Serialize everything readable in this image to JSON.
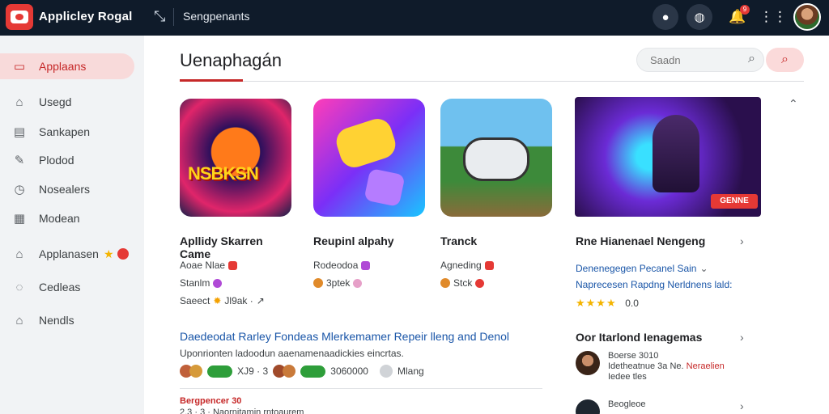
{
  "app": {
    "title": "Applicley Rogal",
    "breadcrumb": "Sengpenants"
  },
  "topbar": {
    "notification_count": "9"
  },
  "sidebar": {
    "items": [
      {
        "label": "Applaans",
        "icon": "store-icon",
        "active": true
      },
      {
        "label": "Usegd",
        "icon": "bag-icon"
      },
      {
        "label": "Sankapen",
        "icon": "library-icon"
      },
      {
        "label": "Plodod",
        "icon": "edit-icon"
      },
      {
        "label": "Nosealers",
        "icon": "clock-icon"
      },
      {
        "label": "Modean",
        "icon": "grid-icon"
      },
      {
        "label": "Applanasen",
        "icon": "home-icon"
      },
      {
        "label": "Cedleas",
        "icon": "chat-icon"
      },
      {
        "label": "Nendls",
        "icon": "house-icon"
      }
    ]
  },
  "main": {
    "title": "Uenaphagán",
    "search": {
      "placeholder": "Saadn"
    },
    "apps": [
      {
        "name": "Apllidy Skarren Came",
        "meta1": "Aoae Nlae",
        "meta2": "Stanlm",
        "meta3": "Saeect",
        "meta3b": "Jl9ak ·",
        "image_text": "NSBKSN"
      },
      {
        "name": "Reupinl alpahy",
        "meta1": "Rodeodoa",
        "meta2": "3ptek"
      },
      {
        "name": "Tranck",
        "meta1": "Agneding",
        "meta2": "Stck"
      }
    ],
    "featured_app": {
      "name": "Rne Hianenael Nengeng",
      "tag": "GENNE",
      "line1": "Denenegegen Pecanel Sain",
      "line2": "Naprecesen Rapdng Nerldnens lald:",
      "rating": "0.0"
    },
    "article": {
      "title": "Daedeodat Rarley Fondeas Mlerkemamer Repeir lleng and Denol",
      "subtitle": "Uponrionten ladoodun aaenamenaadickies eincrtas.",
      "meta_left": "XJ9 · 3",
      "meta_right": "3060000",
      "meta_name": "Mlang",
      "footer_label": "Bergpencer 30",
      "footer_text": "2.3 · 3 · Naornitamin rntoaurem"
    },
    "people": {
      "title": "Oor Itarlond Ienagemas",
      "rows": [
        {
          "line1": "Boerse 3010",
          "line2": "Idetheatnue 3a Ne.",
          "line2_red": "Neraelien",
          "line3": "Iedee tles"
        },
        {
          "line1": "Beogleoe"
        }
      ]
    }
  }
}
